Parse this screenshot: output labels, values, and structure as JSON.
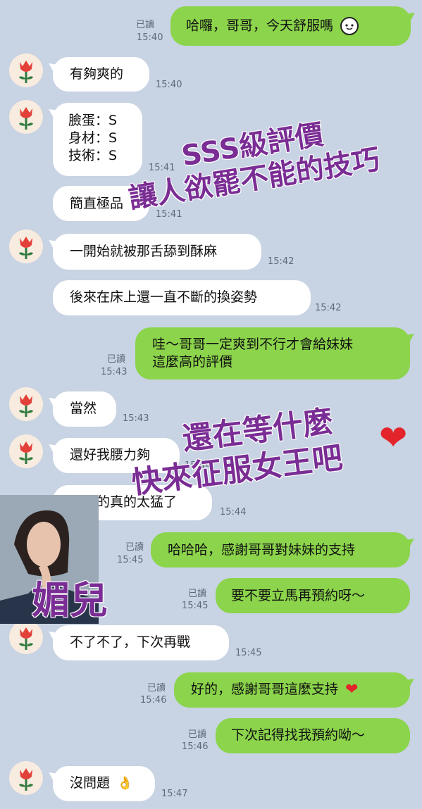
{
  "chat": {
    "read_label": "已讀",
    "messages": [
      {
        "text": "哈囉，哥哥，今天舒服嗎",
        "time": "15:40"
      },
      {
        "text": "有夠爽的",
        "time": "15:40"
      },
      {
        "lines": [
          "臉蛋：S",
          "身材：S",
          "技術：S"
        ],
        "time": "15:41"
      },
      {
        "text": "簡直極品",
        "time": "15:41"
      },
      {
        "text": "一開始就被那舌舔到酥麻",
        "time": "15:42"
      },
      {
        "text": "後來在床上還一直不斷的換姿勢",
        "time": "15:42"
      },
      {
        "lines": [
          "哇～哥哥一定爽到不行才會給妹妹",
          "這麼高的評價"
        ],
        "time": "15:43"
      },
      {
        "text": "當然",
        "time": "15:43"
      },
      {
        "text": "還好我腰力夠",
        "time": "15:44"
      },
      {
        "text": "你家的真的太猛了",
        "time": "15:44"
      },
      {
        "text": "哈哈哈，感謝哥哥對妹妹的支持",
        "time": "15:45"
      },
      {
        "text": "要不要立馬再預約呀～",
        "time": "15:45"
      },
      {
        "text": "不了不了，下次再戰",
        "time": "15:45"
      },
      {
        "text": "好的，感謝哥哥這麼支持",
        "time": "15:46"
      },
      {
        "text": "下次記得找我預約呦～",
        "time": "15:46"
      },
      {
        "text": "沒問題",
        "time": "15:47"
      }
    ]
  },
  "overlays": {
    "rating_line1": "SSS級評價",
    "rating_line2": "讓人欲罷不能的技巧",
    "promo_line1": "還在等什麼",
    "promo_line2": "快來征服女王吧",
    "name_tag": "媚兒"
  },
  "icons": {
    "avatar": "red-tulip-icon",
    "emoji_face": "smiling-face-icon",
    "emoji_ok": "ok-hand-icon",
    "emoji_heart": "red-heart-icon"
  },
  "colors": {
    "background": "#c8d3e3",
    "outgoing_bubble": "#8bd44b",
    "incoming_bubble": "#ffffff",
    "overlay_text": "#7a2d94",
    "heart": "#e3242b"
  }
}
